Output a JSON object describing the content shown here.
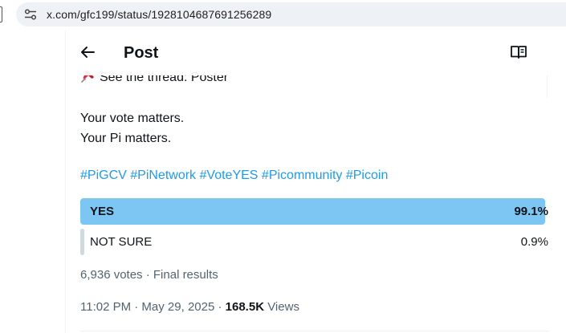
{
  "browser": {
    "url": "x.com/gfc199/status/1928104687691256289",
    "site_info_icon": "tune-icon"
  },
  "header": {
    "title": "Post",
    "back_icon": "arrow-left-icon",
    "reader_icon": "open-book-icon"
  },
  "post": {
    "thread_link": "See the thread: Poster",
    "thread_icon": "pushpin-icon",
    "text_lines": [
      "Your vote matters.",
      "Your Pi matters."
    ],
    "hashtags": [
      "#PiGCV",
      "#PiNetwork",
      "#VoteYES",
      "#Picommunity",
      "#Picoin"
    ],
    "poll": {
      "options": [
        {
          "label": "YES",
          "percent_text": "99.1%",
          "fraction": 0.991,
          "winner": true
        },
        {
          "label": "NOT SURE",
          "percent_text": "0.9%",
          "fraction": 0.009,
          "winner": false
        }
      ],
      "votes_summary": "6,936 votes · Final results"
    },
    "time": "11:02 PM · May 29, 2025 · ",
    "views_count": "168.5K",
    "views_label": " Views"
  },
  "colors": {
    "accent": "#1d9bf0",
    "poll_winner": "#7dc6f4",
    "poll_other": "#cfd9de",
    "secondary_text": "#536471"
  }
}
